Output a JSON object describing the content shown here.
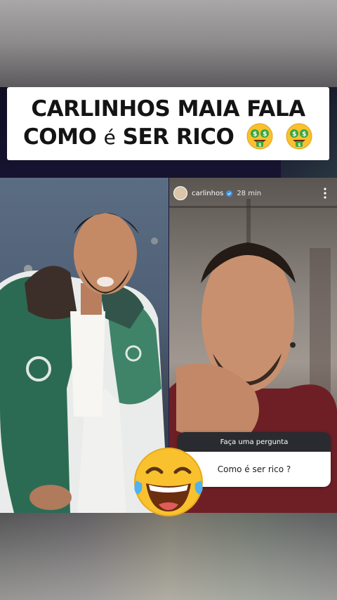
{
  "title": {
    "line1": "CARLINHOS MAIA FALA",
    "line2_a": "COMO",
    "line2_b": "é",
    "line2_c": "SER RICO",
    "emoji_icons": [
      "money-mouth-face-icon",
      "money-mouth-face-icon"
    ]
  },
  "story": {
    "username": "carlinhos",
    "time": "28 min",
    "question_header": "Faça uma pergunta",
    "question_answer": "Como é ser rico ?"
  },
  "overlay": {
    "emoji_icon": "face-with-tears-of-joy-icon"
  },
  "colors": {
    "title_card": "#ffffff",
    "title_text": "#141414",
    "question_header_bg": "#2a2b30",
    "video_bg": "#1f1a44",
    "emoji_yellow": "#f9c12e"
  }
}
